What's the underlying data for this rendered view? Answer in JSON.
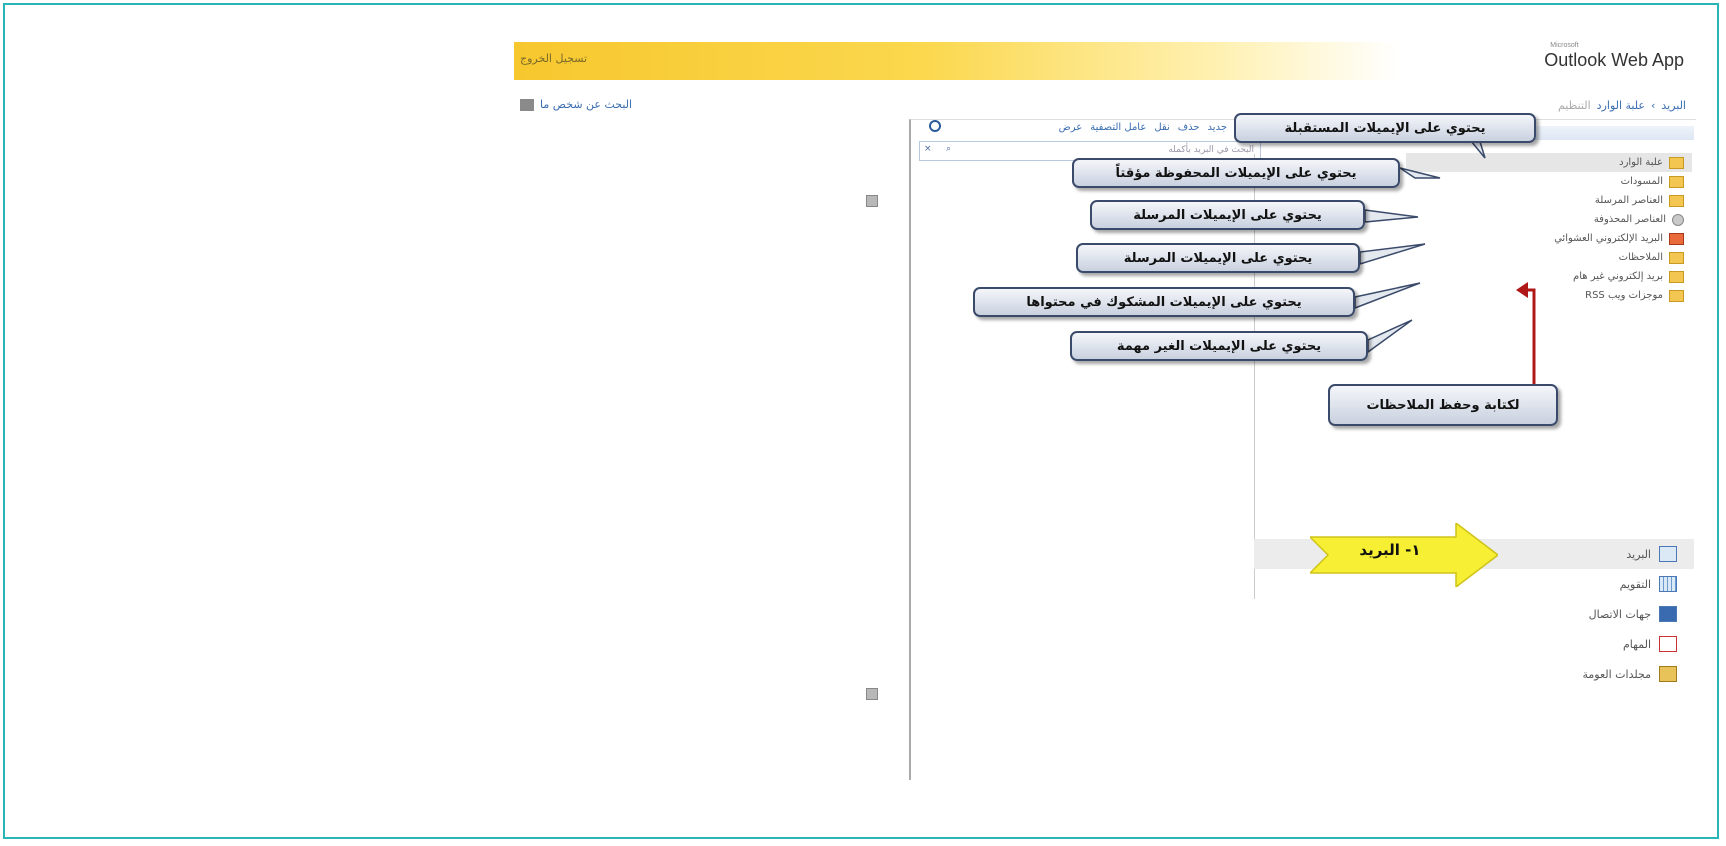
{
  "app": {
    "logo": "Outlook Web App",
    "logo_small": "Microsoft",
    "sign_out": "تسجيل الخروج",
    "find_someone": "البحث عن شخص ما"
  },
  "breadcrumb": {
    "root": "البريد",
    "current": "علبة الوارد",
    "sub": "التنظيم"
  },
  "toolbar": {
    "items": [
      "جديد",
      "حذف",
      "نقل",
      "عامل التصفية",
      "عرض"
    ]
  },
  "search": {
    "placeholder": "البحث في البريد بأكمله"
  },
  "folders": [
    {
      "label": "علبة الوارد",
      "icon": "inbox-folder-icon"
    },
    {
      "label": "المسودات",
      "icon": "drafts-folder-icon"
    },
    {
      "label": "العناصر المرسلة",
      "icon": "sent-items-folder-icon"
    },
    {
      "label": "العناصر المحذوفة",
      "icon": "deleted-items-folder-icon"
    },
    {
      "label": "البريد الإلكتروني العشوائي",
      "icon": "junk-folder-icon"
    },
    {
      "label": "الملاحظات",
      "icon": "notes-folder-icon"
    },
    {
      "label": "بريد إلكتروني غير هام",
      "icon": "folder-icon"
    },
    {
      "label": "موجزات ويب RSS",
      "icon": "rss-folder-icon"
    }
  ],
  "nav": {
    "dots": "......",
    "items": [
      {
        "label": "البريد",
        "icon": "mail-icon"
      },
      {
        "label": "التقويم",
        "icon": "calendar-icon"
      },
      {
        "label": "جهات الاتصال",
        "icon": "contacts-icon"
      },
      {
        "label": "المهام",
        "icon": "tasks-icon"
      },
      {
        "label": "مجلدات العومة",
        "icon": "public-folders-icon"
      }
    ]
  },
  "callouts": {
    "inbox": "يحتوي على الإيميلات المستقبلة",
    "drafts": "يحتوي على الإيميلات المحفوظة مؤقتاً",
    "sent": "يحتوي على الإيميلات المرسلة",
    "deleted": "يحتوي على الإيميلات المرسلة",
    "junk": "يحتوي على الإيميلات المشكوك في محتواها",
    "unimportant": "يحتوي على الإيميلات الغير مهمة",
    "notes": "لكتابة وحفظ الملاحظات"
  },
  "mail_arrow": "١- البريد"
}
